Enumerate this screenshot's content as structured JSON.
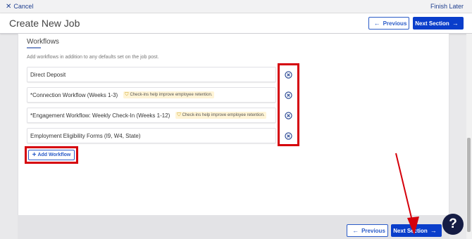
{
  "topbar": {
    "cancel_label": "Cancel",
    "finish_label": "Finish Later"
  },
  "header": {
    "title": "Create New Job",
    "previous_label": "Previous",
    "next_label": "Next Section"
  },
  "workflows": {
    "title": "Workflows",
    "description": "Add workflows in addition to any defaults set on the job post.",
    "items": [
      {
        "name": "Direct Deposit",
        "hint": ""
      },
      {
        "name": "*Connection Workflow (Weeks 1-3)",
        "hint": "Check-ins help improve employee retention."
      },
      {
        "name": "*Engagement Workflow: Weekly Check-In (Weeks 1-12)",
        "hint": "Check-ins help improve employee retention."
      },
      {
        "name": "Employment Eligibility Forms (I9, W4, State)",
        "hint": ""
      }
    ],
    "add_label": "Add Workflow"
  },
  "footer": {
    "previous_label": "Previous",
    "next_label": "Next Section"
  },
  "help": {
    "label": "?"
  },
  "colors": {
    "primary": "#0a3ecb",
    "annotation": "#d5000b",
    "hint_bg": "#fff4d6",
    "help_bg": "#151c44"
  },
  "icons": {
    "remove": "circle-x-icon",
    "hint": "badge-icon",
    "previous": "arrow-left-icon",
    "next": "arrow-right-icon",
    "add": "plus-icon"
  }
}
